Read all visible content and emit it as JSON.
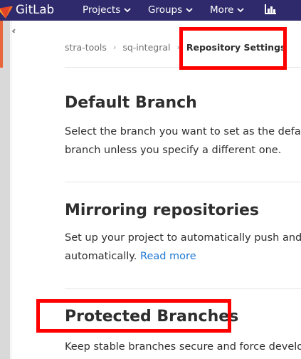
{
  "navbar": {
    "brand": "GitLab",
    "items": [
      {
        "label": "Projects"
      },
      {
        "label": "Groups"
      },
      {
        "label": "More"
      }
    ],
    "logo_icon": "gitlab-tanuki-icon",
    "activity_icon": "chart-bar-icon",
    "background": "#2f2a6b"
  },
  "breadcrumb": {
    "items": [
      "stra-tools",
      "sq-integral"
    ],
    "current": "Repository Settings"
  },
  "sections": [
    {
      "title": "Default Branch",
      "lines": [
        "Select the branch you want to set as the defa",
        "branch unless you specify a different one."
      ]
    },
    {
      "title": "Mirroring repositories",
      "lines": [
        "Set up your project to automatically push and",
        "automatically."
      ],
      "link": "Read more"
    },
    {
      "title": "Protected Branches",
      "lines": [
        "Keep stable branches secure and force develo"
      ]
    }
  ],
  "colors": {
    "highlight": "#ff0000",
    "link": "#1f78d1",
    "accent": "#e8663a"
  }
}
